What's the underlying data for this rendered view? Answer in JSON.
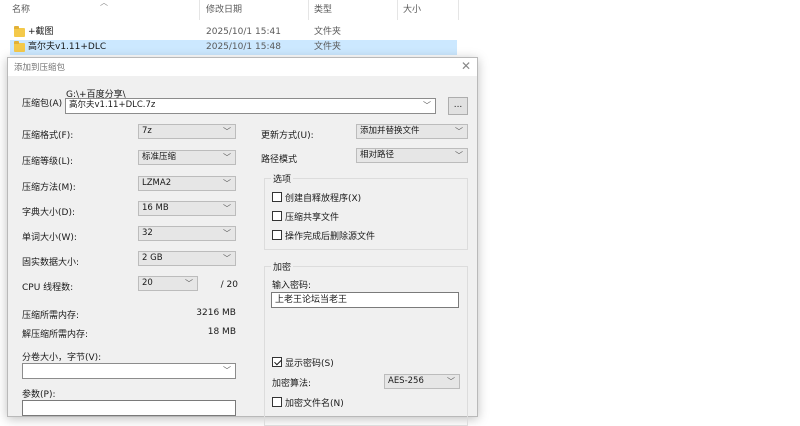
{
  "explorer": {
    "columns": {
      "name": "名称",
      "date": "修改日期",
      "type": "类型",
      "size": "大小"
    },
    "files": [
      {
        "name": "+截图",
        "date": "2025/10/1 15:41",
        "type": "文件夹"
      },
      {
        "name": "高尔夫v1.11+DLC",
        "date": "2025/10/1 15:48",
        "type": "文件夹"
      }
    ]
  },
  "dialog": {
    "title": "添加到压缩包",
    "close_glyph": "✕",
    "archive": {
      "label": "压缩包(A)",
      "path": "G:\\+百度分享\\",
      "filename": "高尔夫v1.11+DLC.7z",
      "browse_label": "..."
    },
    "left": {
      "format": {
        "label": "压缩格式(F):",
        "value": "7z"
      },
      "level": {
        "label": "压缩等级(L):",
        "value": "标准压缩"
      },
      "method": {
        "label": "压缩方法(M):",
        "value": "LZMA2"
      },
      "dict": {
        "label": "字典大小(D):",
        "value": "16 MB"
      },
      "word": {
        "label": "单词大小(W):",
        "value": "32"
      },
      "solid": {
        "label": "固实数据大小:",
        "value": "2 GB"
      },
      "threads": {
        "label": "CPU 线程数:",
        "value": "20",
        "max": "/ 20"
      },
      "mem_comp": {
        "label": "压缩所需内存:",
        "value": "3216 MB"
      },
      "mem_decomp": {
        "label": "解压缩所需内存:",
        "value": "18 MB"
      },
      "volume": {
        "label": "分卷大小，字节(V):",
        "value": ""
      },
      "params": {
        "label": "参数(P):",
        "value": ""
      }
    },
    "right": {
      "update": {
        "label": "更新方式(U):",
        "value": "添加并替换文件"
      },
      "path_mode": {
        "label": "路径模式",
        "value": "相对路径"
      },
      "options": {
        "title": "选项",
        "sfx": {
          "label": "创建自释放程序(X)",
          "checked": false
        },
        "shared": {
          "label": "压缩共享文件",
          "checked": false
        },
        "delete": {
          "label": "操作完成后删除源文件",
          "checked": false
        }
      },
      "encryption": {
        "title": "加密",
        "password_label": "输入密码:",
        "password_value": "上老王论坛当老王",
        "show_password": {
          "label": "显示密码(S)",
          "checked": true
        },
        "method_label": "加密算法:",
        "method_value": "AES-256",
        "encrypt_names": {
          "label": "加密文件名(N)",
          "checked": false
        }
      }
    },
    "caret_glyph": "﹀"
  }
}
